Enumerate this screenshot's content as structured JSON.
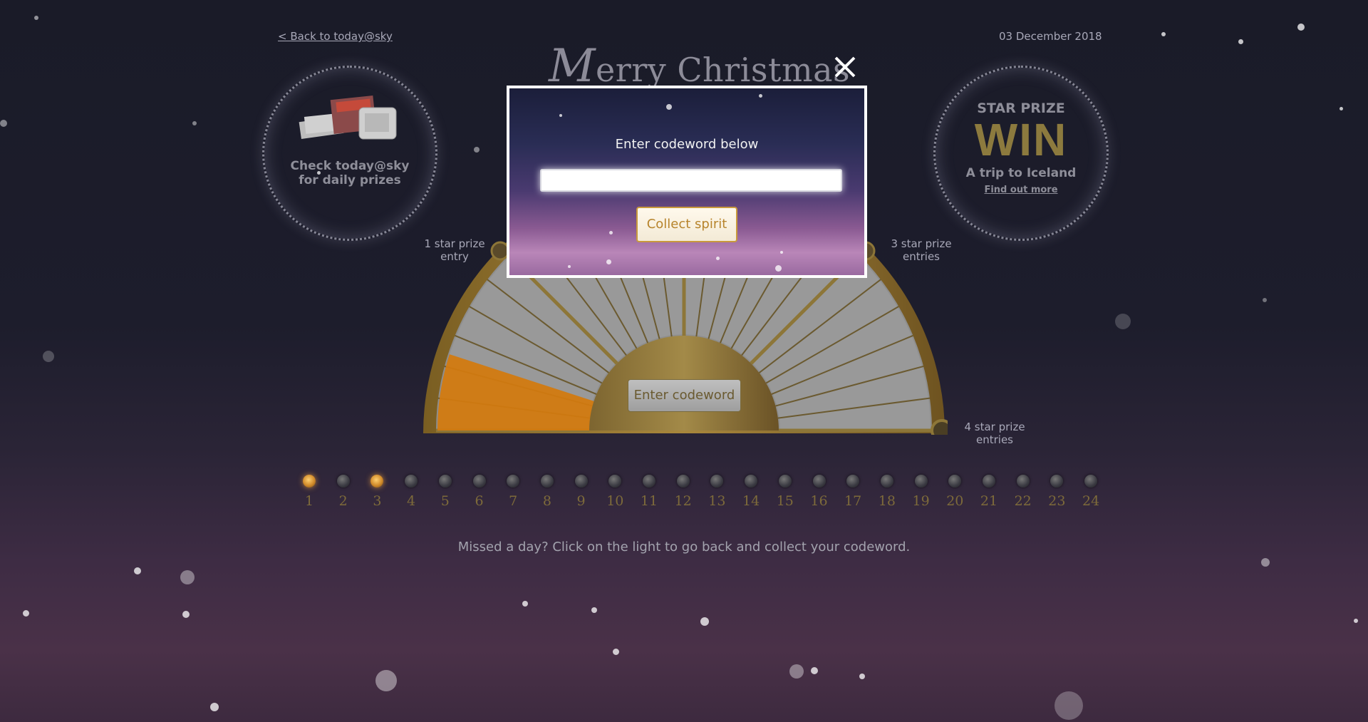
{
  "header": {
    "back_link": "< Back to today@sky",
    "date": "03 December 2018",
    "title": "Merry Christmas",
    "title_initial": "M",
    "title_rest": "erry Christmas"
  },
  "left_promo": {
    "line1": "Check today@sky",
    "line2": "for daily prizes",
    "image_icon": "prizes-image"
  },
  "right_promo": {
    "label": "STAR PRIZE",
    "headline": "WIN",
    "subtitle": "A trip to Iceland",
    "link": "Find out more"
  },
  "meter": {
    "label_1_a": "1 star prize",
    "label_1_b": "entry",
    "label_3_a": "3 star prize",
    "label_3_b": "entries",
    "label_4_a": "4 star prize",
    "label_4_b": "entries",
    "fill_fraction": 0.1,
    "enter_button": "Enter codeword"
  },
  "days": [
    {
      "num": "1",
      "lit": true
    },
    {
      "num": "2",
      "lit": false
    },
    {
      "num": "3",
      "lit": true
    },
    {
      "num": "4",
      "lit": false
    },
    {
      "num": "5",
      "lit": false
    },
    {
      "num": "6",
      "lit": false
    },
    {
      "num": "7",
      "lit": false
    },
    {
      "num": "8",
      "lit": false
    },
    {
      "num": "9",
      "lit": false
    },
    {
      "num": "10",
      "lit": false
    },
    {
      "num": "11",
      "lit": false
    },
    {
      "num": "12",
      "lit": false
    },
    {
      "num": "13",
      "lit": false
    },
    {
      "num": "14",
      "lit": false
    },
    {
      "num": "15",
      "lit": false
    },
    {
      "num": "16",
      "lit": false
    },
    {
      "num": "17",
      "lit": false
    },
    {
      "num": "18",
      "lit": false
    },
    {
      "num": "19",
      "lit": false
    },
    {
      "num": "20",
      "lit": false
    },
    {
      "num": "21",
      "lit": false
    },
    {
      "num": "22",
      "lit": false
    },
    {
      "num": "23",
      "lit": false
    },
    {
      "num": "24",
      "lit": false
    }
  ],
  "missed_text": "Missed a day? Click on the light to go back and collect your codeword.",
  "modal": {
    "title": "Enter codeword below",
    "input_value": "",
    "input_placeholder": "",
    "button": "Collect spirit",
    "close_icon": "close-icon"
  },
  "colors": {
    "gold": "#c99a3c",
    "meter_orange": "#e08a10",
    "dim_text": "#a8a8b8"
  }
}
